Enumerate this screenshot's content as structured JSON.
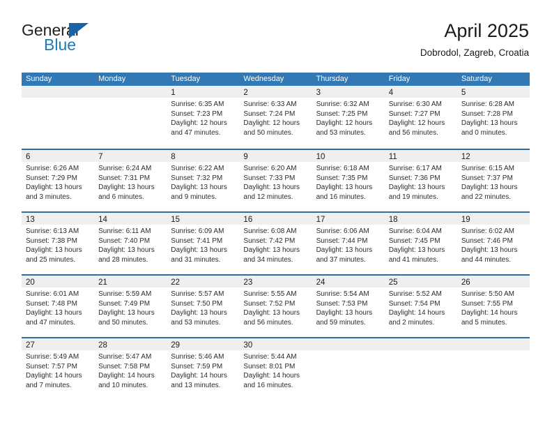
{
  "brand": {
    "name_part1": "General",
    "name_part2": "Blue",
    "accent_color": "#1763a8",
    "logo_icon": "triangle-flag-icon"
  },
  "header": {
    "title": "April 2025",
    "subtitle": "Dobrodol, Zagreb, Croatia"
  },
  "theme": {
    "header_blue": "#3178b4",
    "row_divider_blue": "#2e6da4",
    "date_band_gray": "#efefef",
    "text_color": "#1a1a1a"
  },
  "weekdays": [
    "Sunday",
    "Monday",
    "Tuesday",
    "Wednesday",
    "Thursday",
    "Friday",
    "Saturday"
  ],
  "weeks": [
    [
      {
        "day": "",
        "lines": []
      },
      {
        "day": "",
        "lines": []
      },
      {
        "day": "1",
        "lines": [
          "Sunrise: 6:35 AM",
          "Sunset: 7:23 PM",
          "Daylight: 12 hours",
          "and 47 minutes."
        ]
      },
      {
        "day": "2",
        "lines": [
          "Sunrise: 6:33 AM",
          "Sunset: 7:24 PM",
          "Daylight: 12 hours",
          "and 50 minutes."
        ]
      },
      {
        "day": "3",
        "lines": [
          "Sunrise: 6:32 AM",
          "Sunset: 7:25 PM",
          "Daylight: 12 hours",
          "and 53 minutes."
        ]
      },
      {
        "day": "4",
        "lines": [
          "Sunrise: 6:30 AM",
          "Sunset: 7:27 PM",
          "Daylight: 12 hours",
          "and 56 minutes."
        ]
      },
      {
        "day": "5",
        "lines": [
          "Sunrise: 6:28 AM",
          "Sunset: 7:28 PM",
          "Daylight: 13 hours",
          "and 0 minutes."
        ]
      }
    ],
    [
      {
        "day": "6",
        "lines": [
          "Sunrise: 6:26 AM",
          "Sunset: 7:29 PM",
          "Daylight: 13 hours",
          "and 3 minutes."
        ]
      },
      {
        "day": "7",
        "lines": [
          "Sunrise: 6:24 AM",
          "Sunset: 7:31 PM",
          "Daylight: 13 hours",
          "and 6 minutes."
        ]
      },
      {
        "day": "8",
        "lines": [
          "Sunrise: 6:22 AM",
          "Sunset: 7:32 PM",
          "Daylight: 13 hours",
          "and 9 minutes."
        ]
      },
      {
        "day": "9",
        "lines": [
          "Sunrise: 6:20 AM",
          "Sunset: 7:33 PM",
          "Daylight: 13 hours",
          "and 12 minutes."
        ]
      },
      {
        "day": "10",
        "lines": [
          "Sunrise: 6:18 AM",
          "Sunset: 7:35 PM",
          "Daylight: 13 hours",
          "and 16 minutes."
        ]
      },
      {
        "day": "11",
        "lines": [
          "Sunrise: 6:17 AM",
          "Sunset: 7:36 PM",
          "Daylight: 13 hours",
          "and 19 minutes."
        ]
      },
      {
        "day": "12",
        "lines": [
          "Sunrise: 6:15 AM",
          "Sunset: 7:37 PM",
          "Daylight: 13 hours",
          "and 22 minutes."
        ]
      }
    ],
    [
      {
        "day": "13",
        "lines": [
          "Sunrise: 6:13 AM",
          "Sunset: 7:38 PM",
          "Daylight: 13 hours",
          "and 25 minutes."
        ]
      },
      {
        "day": "14",
        "lines": [
          "Sunrise: 6:11 AM",
          "Sunset: 7:40 PM",
          "Daylight: 13 hours",
          "and 28 minutes."
        ]
      },
      {
        "day": "15",
        "lines": [
          "Sunrise: 6:09 AM",
          "Sunset: 7:41 PM",
          "Daylight: 13 hours",
          "and 31 minutes."
        ]
      },
      {
        "day": "16",
        "lines": [
          "Sunrise: 6:08 AM",
          "Sunset: 7:42 PM",
          "Daylight: 13 hours",
          "and 34 minutes."
        ]
      },
      {
        "day": "17",
        "lines": [
          "Sunrise: 6:06 AM",
          "Sunset: 7:44 PM",
          "Daylight: 13 hours",
          "and 37 minutes."
        ]
      },
      {
        "day": "18",
        "lines": [
          "Sunrise: 6:04 AM",
          "Sunset: 7:45 PM",
          "Daylight: 13 hours",
          "and 41 minutes."
        ]
      },
      {
        "day": "19",
        "lines": [
          "Sunrise: 6:02 AM",
          "Sunset: 7:46 PM",
          "Daylight: 13 hours",
          "and 44 minutes."
        ]
      }
    ],
    [
      {
        "day": "20",
        "lines": [
          "Sunrise: 6:01 AM",
          "Sunset: 7:48 PM",
          "Daylight: 13 hours",
          "and 47 minutes."
        ]
      },
      {
        "day": "21",
        "lines": [
          "Sunrise: 5:59 AM",
          "Sunset: 7:49 PM",
          "Daylight: 13 hours",
          "and 50 minutes."
        ]
      },
      {
        "day": "22",
        "lines": [
          "Sunrise: 5:57 AM",
          "Sunset: 7:50 PM",
          "Daylight: 13 hours",
          "and 53 minutes."
        ]
      },
      {
        "day": "23",
        "lines": [
          "Sunrise: 5:55 AM",
          "Sunset: 7:52 PM",
          "Daylight: 13 hours",
          "and 56 minutes."
        ]
      },
      {
        "day": "24",
        "lines": [
          "Sunrise: 5:54 AM",
          "Sunset: 7:53 PM",
          "Daylight: 13 hours",
          "and 59 minutes."
        ]
      },
      {
        "day": "25",
        "lines": [
          "Sunrise: 5:52 AM",
          "Sunset: 7:54 PM",
          "Daylight: 14 hours",
          "and 2 minutes."
        ]
      },
      {
        "day": "26",
        "lines": [
          "Sunrise: 5:50 AM",
          "Sunset: 7:55 PM",
          "Daylight: 14 hours",
          "and 5 minutes."
        ]
      }
    ],
    [
      {
        "day": "27",
        "lines": [
          "Sunrise: 5:49 AM",
          "Sunset: 7:57 PM",
          "Daylight: 14 hours",
          "and 7 minutes."
        ]
      },
      {
        "day": "28",
        "lines": [
          "Sunrise: 5:47 AM",
          "Sunset: 7:58 PM",
          "Daylight: 14 hours",
          "and 10 minutes."
        ]
      },
      {
        "day": "29",
        "lines": [
          "Sunrise: 5:46 AM",
          "Sunset: 7:59 PM",
          "Daylight: 14 hours",
          "and 13 minutes."
        ]
      },
      {
        "day": "30",
        "lines": [
          "Sunrise: 5:44 AM",
          "Sunset: 8:01 PM",
          "Daylight: 14 hours",
          "and 16 minutes."
        ]
      },
      {
        "day": "",
        "lines": []
      },
      {
        "day": "",
        "lines": []
      },
      {
        "day": "",
        "lines": []
      }
    ]
  ]
}
